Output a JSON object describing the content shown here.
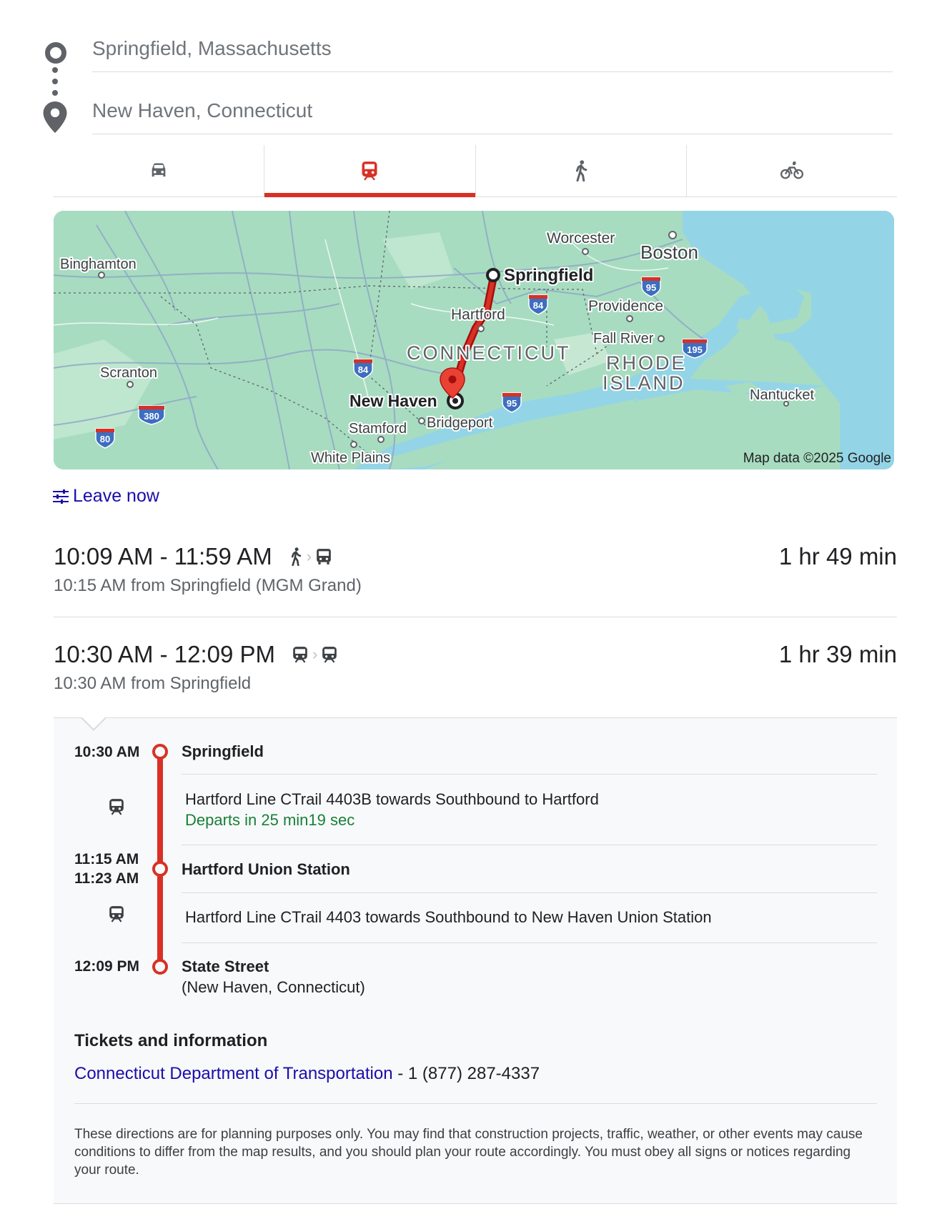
{
  "search": {
    "origin_placeholder": "Springfield, Massachusetts",
    "destination_placeholder": "New Haven, Connecticut"
  },
  "modes": [
    {
      "name": "driving",
      "icon": "car-icon",
      "active": false
    },
    {
      "name": "transit",
      "icon": "train-icon",
      "active": true
    },
    {
      "name": "walking",
      "icon": "walk-icon",
      "active": false
    },
    {
      "name": "cycling",
      "icon": "bike-icon",
      "active": false
    }
  ],
  "map": {
    "labels": {
      "binghamton": "Binghamton",
      "worcester": "Worcester",
      "boston": "Boston",
      "springfield": "Springfield",
      "hartford": "Hartford",
      "providence": "Providence",
      "fall_river": "Fall River",
      "connecticut": "CONNECTICUT",
      "rhode": "RHODE",
      "island": "ISLAND",
      "scranton": "Scranton",
      "new_haven": "New Haven",
      "stamford": "Stamford",
      "bridgeport": "Bridgeport",
      "white_plains": "White Plains",
      "nantucket": "Nantucket"
    },
    "shields": {
      "i95_ne": "95",
      "i84_e": "84",
      "i195": "195",
      "i84_w": "84",
      "i95_ct": "95",
      "i380": "380",
      "i80": "80"
    },
    "copyright": "Map data ©2025 Google",
    "colors": {
      "land": "#a7dcc0",
      "water": "#94d4e7",
      "route": "#d93025"
    }
  },
  "leave_now": "Leave now",
  "routes": [
    {
      "time_range": "10:09 AM - 11:59 AM",
      "duration": "1 hr 49 min",
      "departure": "10:15 AM from Springfield (MGM Grand)",
      "modes": [
        "walk-icon",
        "bus-icon"
      ]
    },
    {
      "time_range": "10:30 AM - 12:09 PM",
      "duration": "1 hr 39 min",
      "departure": "10:30 AM from Springfield",
      "modes": [
        "train-icon",
        "train-icon"
      ]
    }
  ],
  "details": {
    "stops": [
      {
        "time": "10:30 AM",
        "name": "Springfield"
      },
      {
        "time_arrive": "11:15 AM",
        "time_depart": "11:23 AM",
        "name": "Hartford Union Station"
      },
      {
        "time": "12:09 PM",
        "name": "State Street",
        "sub": "(New Haven, Connecticut)"
      }
    ],
    "segments": [
      {
        "line": "Hartford Line CTrail 4403B towards Southbound to Hartford",
        "status": "Departs in 25 min19 sec"
      },
      {
        "line": "Hartford Line CTrail 4403 towards Southbound to New Haven Union Station"
      }
    ],
    "tickets_heading": "Tickets and information",
    "agency": "Connecticut Department of Transportation",
    "phone": " - 1 (877) 287-4337",
    "disclaimer": "These directions are for planning purposes only. You may find that construction projects, traffic, weather, or other events may cause conditions to differ from the map results, and you should plan your route accordingly. You must obey all signs or notices regarding your route."
  }
}
